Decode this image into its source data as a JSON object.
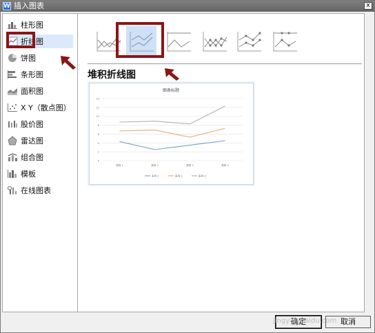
{
  "window": {
    "title": "插入图表",
    "app_icon_letter": "W",
    "close_glyph": "x"
  },
  "sidebar": {
    "items": [
      {
        "label": "柱形图",
        "icon": "column-chart-icon"
      },
      {
        "label": "折线图",
        "icon": "line-chart-icon",
        "selected": true
      },
      {
        "label": "饼图",
        "icon": "pie-chart-icon"
      },
      {
        "label": "条形图",
        "icon": "bar-chart-icon"
      },
      {
        "label": "面积图",
        "icon": "area-chart-icon"
      },
      {
        "label": "X Y（散点图）",
        "icon": "scatter-chart-icon"
      },
      {
        "label": "股价图",
        "icon": "stock-chart-icon"
      },
      {
        "label": "雷达图",
        "icon": "radar-chart-icon"
      },
      {
        "label": "组合图",
        "icon": "combo-chart-icon"
      },
      {
        "label": "模板",
        "icon": "template-icon"
      },
      {
        "label": "在线图表",
        "icon": "online-chart-icon"
      }
    ]
  },
  "subtypes": [
    {
      "name": "line"
    },
    {
      "name": "stacked-line",
      "selected": true
    },
    {
      "name": "percent-stacked-line"
    },
    {
      "name": "line-with-markers"
    },
    {
      "name": "stacked-line-with-markers"
    },
    {
      "name": "percent-stacked-line-with-markers"
    }
  ],
  "main": {
    "section_title": "堆积折线图"
  },
  "chart_data": {
    "type": "line",
    "title": "图表标题",
    "categories": [
      "类别 1",
      "类别 2",
      "类别 3",
      "类别 4"
    ],
    "series": [
      {
        "name": "系列 1",
        "values": [
          4.3,
          2.5,
          3.5,
          4.5
        ],
        "color": "#7fa9d0"
      },
      {
        "name": "系列 2",
        "values": [
          6.7,
          6.9,
          5.3,
          7.3
        ],
        "color": "#efae7a"
      },
      {
        "name": "系列 3",
        "values": [
          8.7,
          8.9,
          8.3,
          12.3
        ],
        "color": "#b7b7b7"
      }
    ],
    "y_ticks": [
      "0",
      "2",
      "4",
      "6",
      "8",
      "10",
      "12",
      "14"
    ],
    "ylim": [
      0,
      14
    ],
    "grid": true,
    "legend_position": "bottom"
  },
  "footer": {
    "ok_label": "确定",
    "cancel_label": "取消",
    "watermark": "jingyan.baidu.com"
  },
  "annotations": {
    "highlight_color": "#8b1515"
  }
}
